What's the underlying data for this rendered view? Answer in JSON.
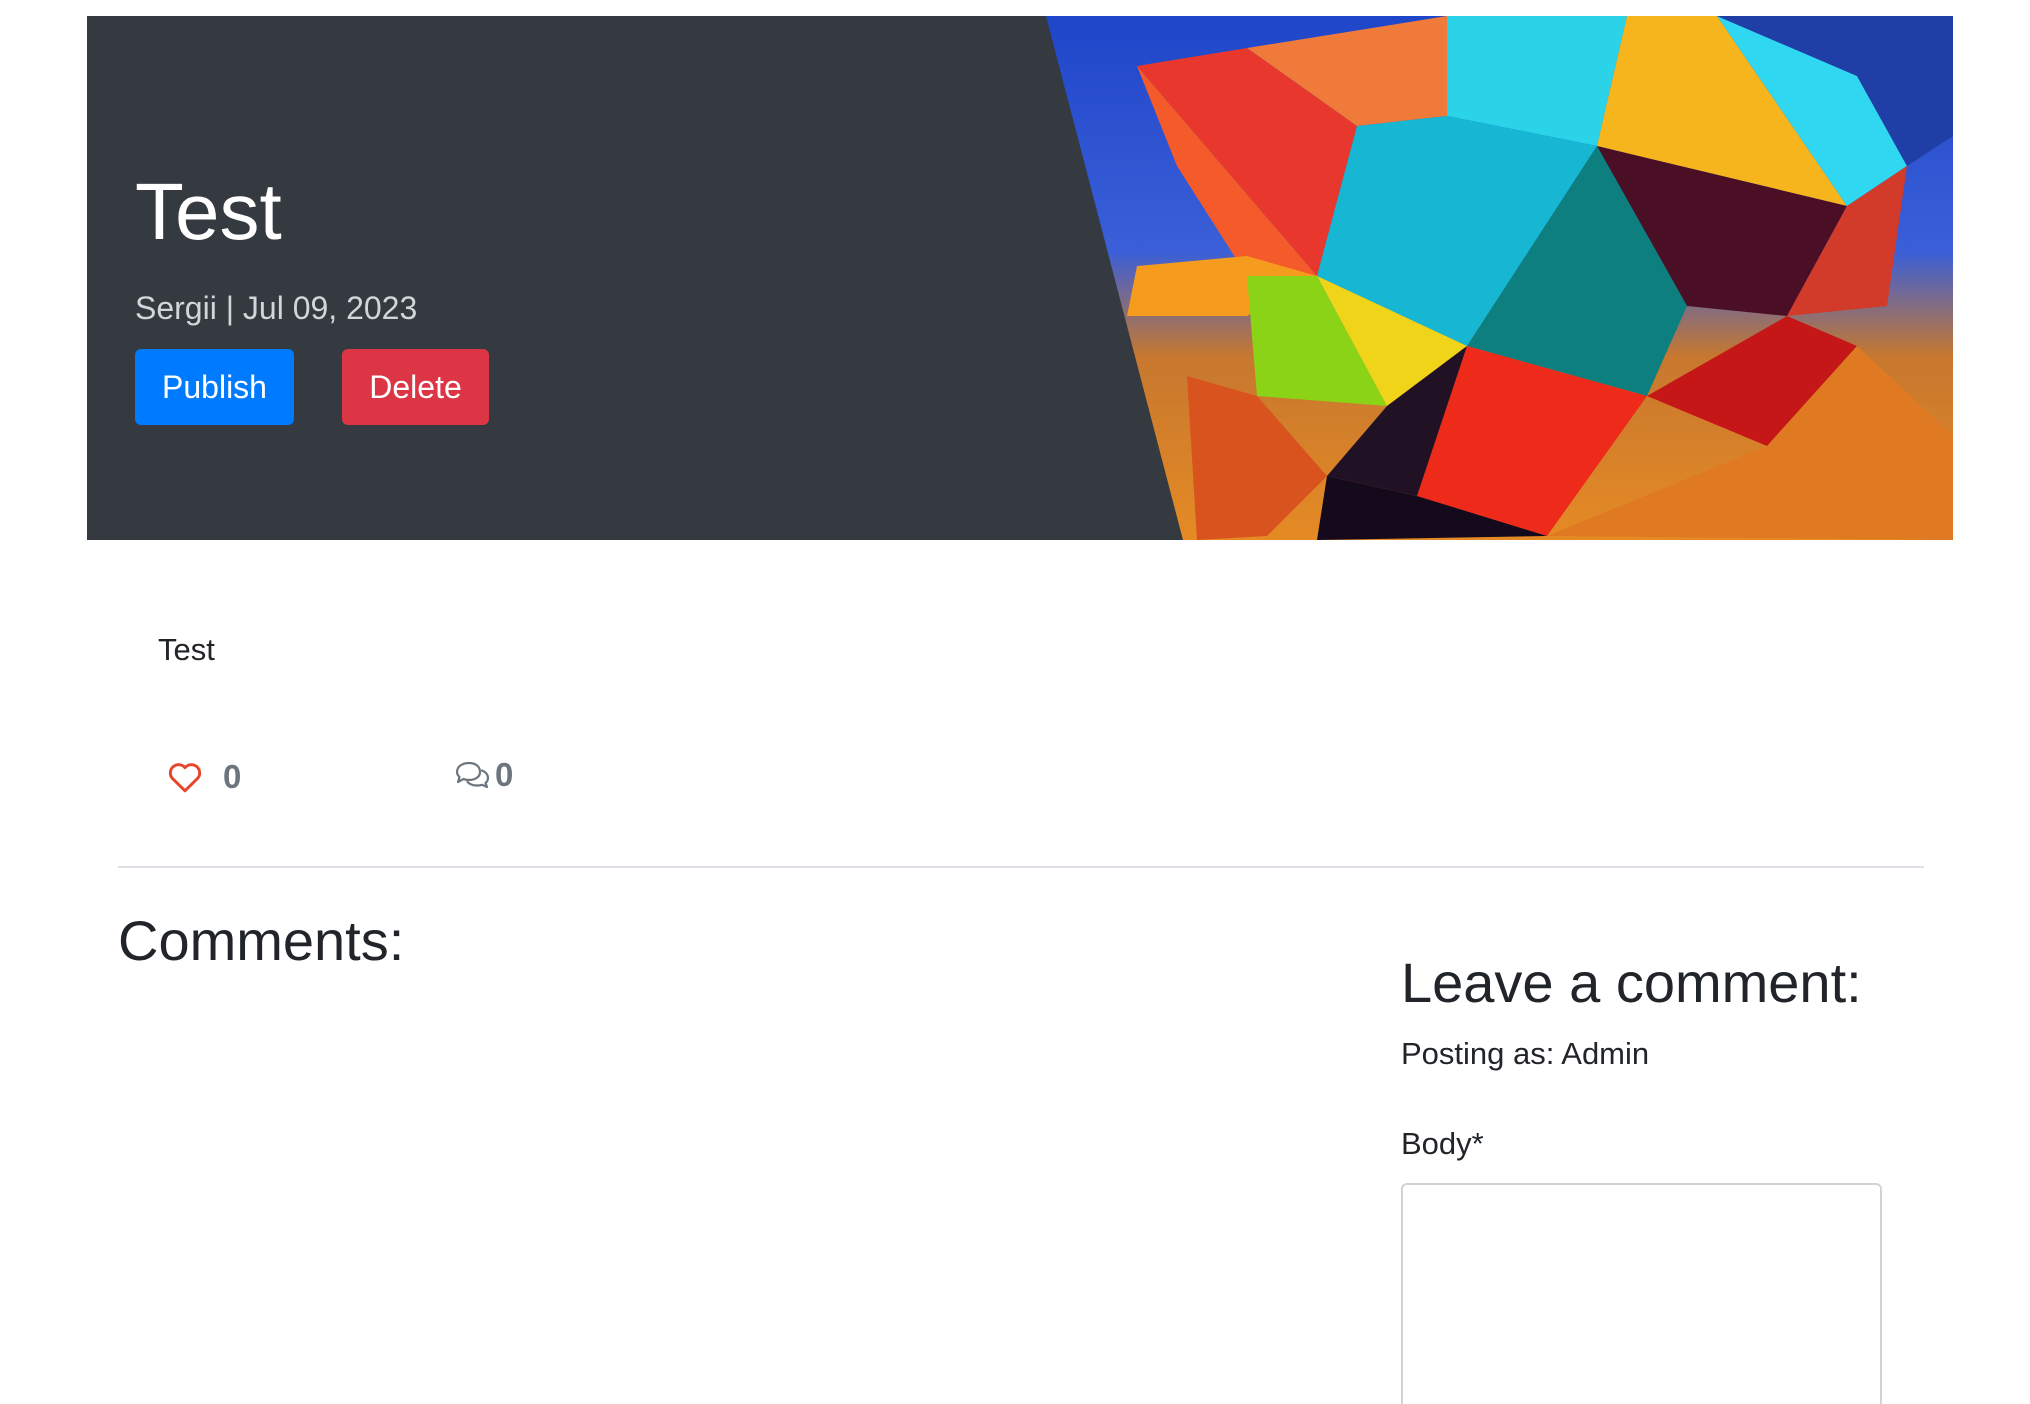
{
  "post": {
    "title": "Test",
    "meta": "Sergii | Jul 09, 2023",
    "body": "Test"
  },
  "actions": {
    "publish_label": "Publish",
    "delete_label": "Delete"
  },
  "stats": {
    "likes": "0",
    "comments": "0"
  },
  "comments_section": {
    "title": "Comments:"
  },
  "comment_form": {
    "title": "Leave a comment:",
    "posting_as": "Posting as: Admin",
    "body_label": "Body*",
    "body_value": ""
  },
  "icons": {
    "like": "heart-outline-icon",
    "comments": "chat-bubbles-icon"
  },
  "colors": {
    "hero_bg": "#343a40",
    "publish": "#007bff",
    "delete": "#dc3545",
    "heart": "#e8452c",
    "muted": "#6c757d"
  }
}
